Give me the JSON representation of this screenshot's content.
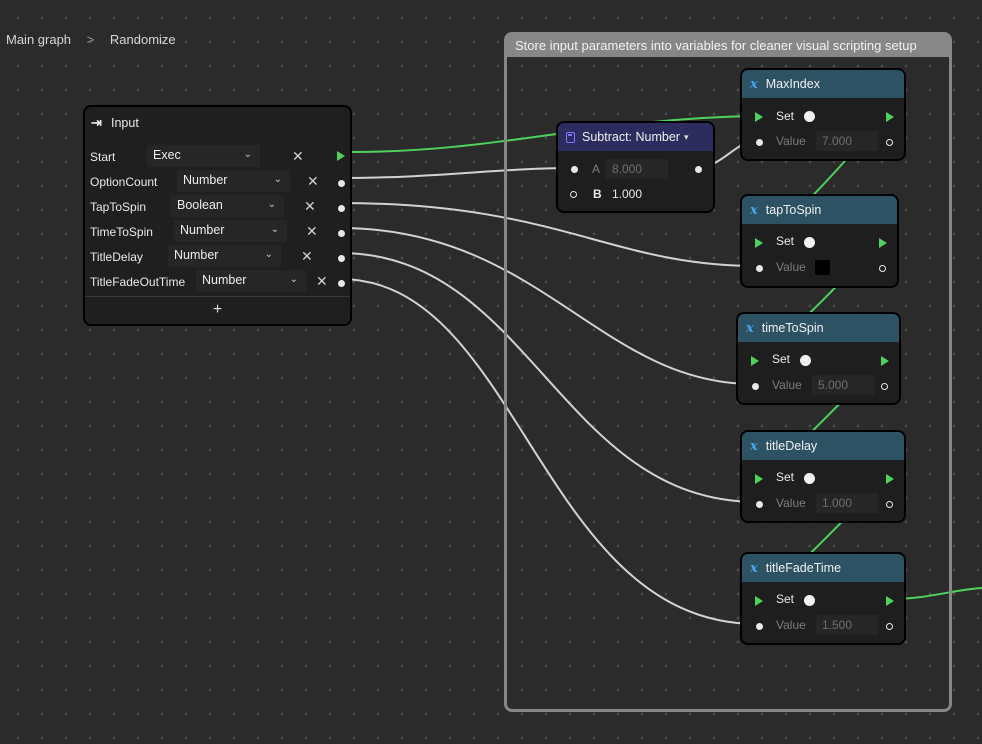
{
  "breadcrumb": {
    "root": "Main graph",
    "separator": ">",
    "current": "Randomize"
  },
  "group": {
    "title": "Store input parameters into variables for cleaner visual scripting setup"
  },
  "input_node": {
    "title": "Input",
    "params": [
      {
        "name": "Start",
        "type": "Exec"
      },
      {
        "name": "OptionCount",
        "type": "Number"
      },
      {
        "name": "TapToSpin",
        "type": "Boolean"
      },
      {
        "name": "TimeToSpin",
        "type": "Number"
      },
      {
        "name": "TitleDelay",
        "type": "Number"
      },
      {
        "name": "TitleFadeOutTime",
        "type": "Number"
      }
    ],
    "delete_symbol": "✕",
    "add_symbol": "+"
  },
  "subtract_node": {
    "title": "Subtract: Number",
    "caret": "▾",
    "a_label": "A",
    "a_value": "8.000",
    "b_label": "B",
    "b_value": "1.000"
  },
  "variable_nodes": [
    {
      "title": "MaxIndex",
      "set_label": "Set",
      "value_label": "Value",
      "value": "7.000"
    },
    {
      "title": "tapToSpin",
      "set_label": "Set",
      "value_label": "Value",
      "value": ""
    },
    {
      "title": "timeToSpin",
      "set_label": "Set",
      "value_label": "Value",
      "value": "5.000"
    },
    {
      "title": "titleDelay",
      "set_label": "Set",
      "value_label": "Value",
      "value": "1.000"
    },
    {
      "title": "titleFadeTime",
      "set_label": "Set",
      "value_label": "Value",
      "value": "1.500"
    }
  ],
  "icons": {
    "variable": "x-variable-icon",
    "input": "enter-arrow-icon",
    "calculator": "calculator-icon",
    "chevron": "chevron-down-icon"
  },
  "colors": {
    "exec_wire": "#4fd25c",
    "data_wire": "#d2d2d2",
    "variable_header": "#2d5263",
    "calc_header": "#2c2c5e",
    "variable_icon": "#4aa6ee"
  }
}
